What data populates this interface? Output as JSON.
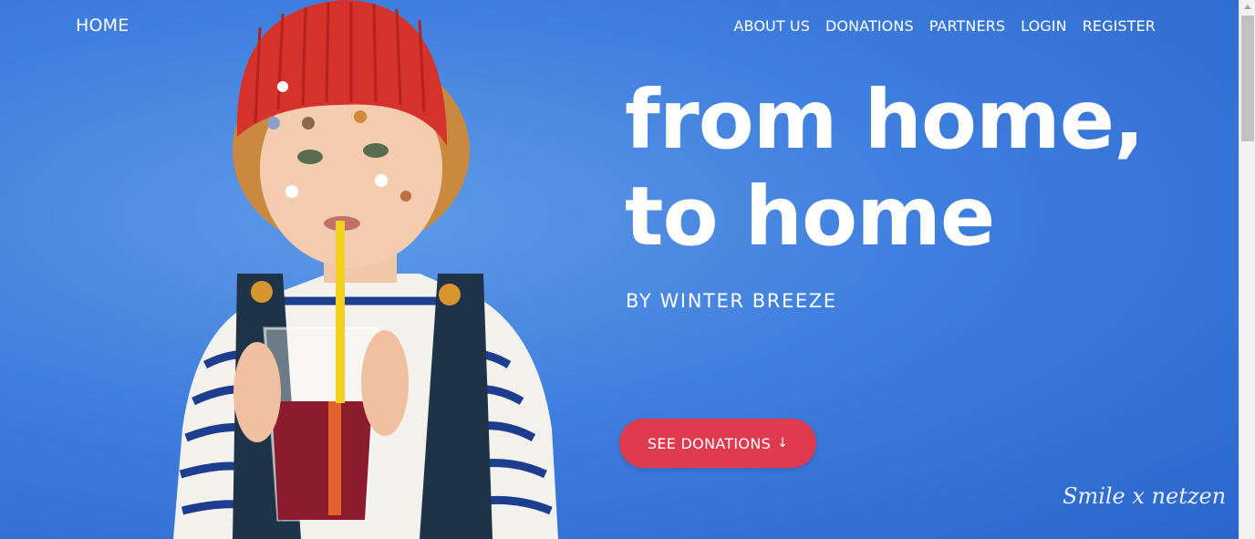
{
  "nav": {
    "home": "HOME",
    "links": [
      "ABOUT US",
      "DONATIONS",
      "PARTNERS",
      "LOGIN",
      "REGISTER"
    ]
  },
  "hero": {
    "headline_line1": "from home,",
    "headline_line2": "to home",
    "byline": "BY WINTER BREEZE",
    "cta_label": "SEE DONATIONS",
    "cta_icon": "arrow-down-icon",
    "signature": "Smile x netzen"
  },
  "colors": {
    "background": "#3f7fde",
    "cta": "#e03a4e",
    "text": "#ffffff"
  },
  "image": {
    "subject": "child-with-beanie-drinking-juice-photo"
  }
}
